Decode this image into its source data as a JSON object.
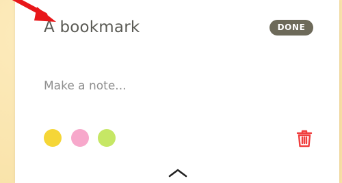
{
  "card": {
    "title": "A bookmark",
    "done_label": "DONE",
    "note_placeholder": "Make a note..."
  },
  "swatches": [
    {
      "name": "yellow",
      "color": "#f5d637"
    },
    {
      "name": "pink",
      "color": "#f7a8cb"
    },
    {
      "name": "green",
      "color": "#c6e765"
    }
  ],
  "colors": {
    "trash": "#f03e3e",
    "arrow": "#e8171a",
    "done_bg": "#6d6a5a"
  },
  "icons": {
    "trash": "trash-icon",
    "expand": "chevron-up-icon",
    "pointer": "arrow-icon"
  }
}
